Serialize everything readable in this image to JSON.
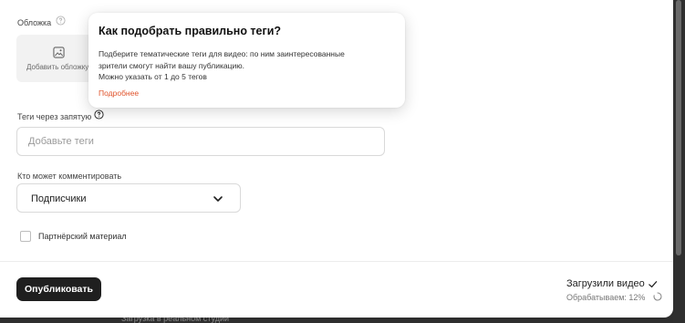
{
  "cover": {
    "label": "Обложка",
    "button_label": "Добавить обложку"
  },
  "tags": {
    "label": "Теги через запятую",
    "placeholder": "Добавьте теги",
    "value": ""
  },
  "comments": {
    "label": "Кто может комментировать",
    "selected": "Подписчики"
  },
  "partner": {
    "label": "Партнёрский материал",
    "checked": false
  },
  "footer": {
    "publish_label": "Опубликовать",
    "status_title": "Загрузили видео",
    "status_progress": "Обрабатываем: 12%",
    "progress_percent": 12
  },
  "tooltip": {
    "title": "Как подобрать правильно теги?",
    "body_line1": "Подберите тематические теги для видео: по ним заинтересованные",
    "body_line2": "зрители смогут найти вашу публикацию.",
    "body_line3": "Можно указать от 1 до 5 тегов",
    "link": "Подробнее"
  },
  "backdrop": {
    "text": "Загрузка в реальном студии"
  },
  "colors": {
    "accent_link": "#e0532b",
    "primary_button": "#1f1f1f"
  },
  "icons": [
    "question-icon",
    "image-icon",
    "chevron-down-icon",
    "check-icon",
    "spinner-icon"
  ]
}
